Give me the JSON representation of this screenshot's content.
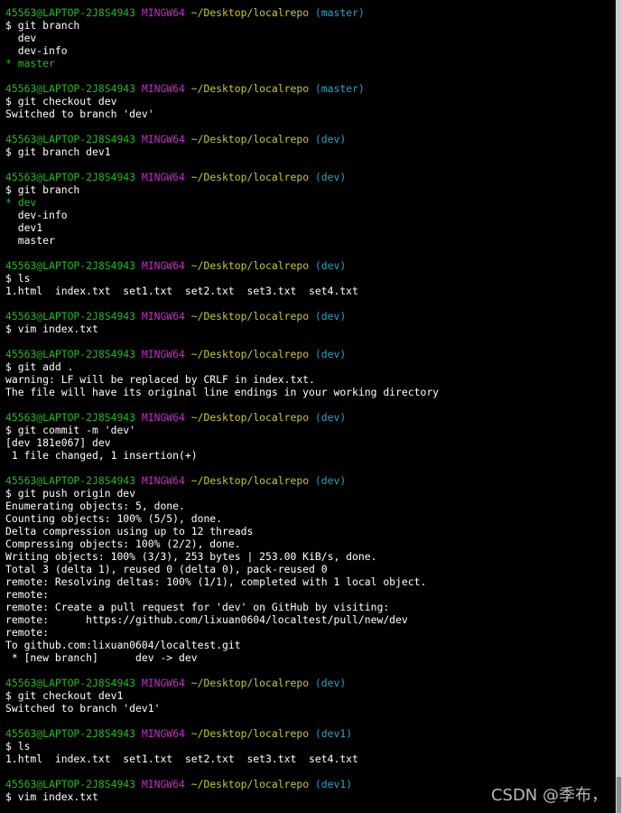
{
  "colors": {
    "background": "#000000",
    "text": "#ffffff",
    "user_host": "#1cbd1c",
    "shell": "#c82bc8",
    "path": "#c8c82b",
    "branch": "#1fa7c8",
    "current_branch": "#1cbd1c"
  },
  "prompt": {
    "user_host": "45563@LAPTOP-2J8S4943",
    "shell": "MINGW64",
    "path": "~/Desktop/localrepo"
  },
  "lines": [
    {
      "type": "prompt",
      "branch": "(master)"
    },
    {
      "type": "cmd",
      "text": "$ git branch"
    },
    {
      "type": "out",
      "text": "  dev"
    },
    {
      "type": "out",
      "text": "  dev-info"
    },
    {
      "type": "cur",
      "text": "* master"
    },
    {
      "type": "blank"
    },
    {
      "type": "prompt",
      "branch": "(master)"
    },
    {
      "type": "cmd",
      "text": "$ git checkout dev"
    },
    {
      "type": "out",
      "text": "Switched to branch 'dev'"
    },
    {
      "type": "blank"
    },
    {
      "type": "prompt",
      "branch": "(dev)"
    },
    {
      "type": "cmd",
      "text": "$ git branch dev1"
    },
    {
      "type": "blank"
    },
    {
      "type": "prompt",
      "branch": "(dev)"
    },
    {
      "type": "cmd",
      "text": "$ git branch"
    },
    {
      "type": "cur",
      "text": "* dev"
    },
    {
      "type": "out",
      "text": "  dev-info"
    },
    {
      "type": "out",
      "text": "  dev1"
    },
    {
      "type": "out",
      "text": "  master"
    },
    {
      "type": "blank"
    },
    {
      "type": "prompt",
      "branch": "(dev)"
    },
    {
      "type": "cmd",
      "text": "$ ls"
    },
    {
      "type": "out",
      "text": "1.html  index.txt  set1.txt  set2.txt  set3.txt  set4.txt"
    },
    {
      "type": "blank"
    },
    {
      "type": "prompt",
      "branch": "(dev)"
    },
    {
      "type": "cmd",
      "text": "$ vim index.txt"
    },
    {
      "type": "blank"
    },
    {
      "type": "prompt",
      "branch": "(dev)"
    },
    {
      "type": "cmd",
      "text": "$ git add ."
    },
    {
      "type": "out",
      "text": "warning: LF will be replaced by CRLF in index.txt."
    },
    {
      "type": "out",
      "text": "The file will have its original line endings in your working directory"
    },
    {
      "type": "blank"
    },
    {
      "type": "prompt",
      "branch": "(dev)"
    },
    {
      "type": "cmd",
      "text": "$ git commit -m 'dev'"
    },
    {
      "type": "out",
      "text": "[dev 181e067] dev"
    },
    {
      "type": "out",
      "text": " 1 file changed, 1 insertion(+)"
    },
    {
      "type": "blank"
    },
    {
      "type": "prompt",
      "branch": "(dev)"
    },
    {
      "type": "cmd",
      "text": "$ git push origin dev"
    },
    {
      "type": "out",
      "text": "Enumerating objects: 5, done."
    },
    {
      "type": "out",
      "text": "Counting objects: 100% (5/5), done."
    },
    {
      "type": "out",
      "text": "Delta compression using up to 12 threads"
    },
    {
      "type": "out",
      "text": "Compressing objects: 100% (2/2), done."
    },
    {
      "type": "out",
      "text": "Writing objects: 100% (3/3), 253 bytes | 253.00 KiB/s, done."
    },
    {
      "type": "out",
      "text": "Total 3 (delta 1), reused 0 (delta 0), pack-reused 0"
    },
    {
      "type": "out",
      "text": "remote: Resolving deltas: 100% (1/1), completed with 1 local object."
    },
    {
      "type": "out",
      "text": "remote:"
    },
    {
      "type": "out",
      "text": "remote: Create a pull request for 'dev' on GitHub by visiting:"
    },
    {
      "type": "out",
      "text": "remote:      https://github.com/lixuan0604/localtest/pull/new/dev"
    },
    {
      "type": "out",
      "text": "remote:"
    },
    {
      "type": "out",
      "text": "To github.com:lixuan0604/localtest.git"
    },
    {
      "type": "out",
      "text": " * [new branch]      dev -> dev"
    },
    {
      "type": "blank"
    },
    {
      "type": "prompt",
      "branch": "(dev)"
    },
    {
      "type": "cmd",
      "text": "$ git checkout dev1"
    },
    {
      "type": "out",
      "text": "Switched to branch 'dev1'"
    },
    {
      "type": "blank"
    },
    {
      "type": "prompt",
      "branch": "(dev1)"
    },
    {
      "type": "cmd",
      "text": "$ ls"
    },
    {
      "type": "out",
      "text": "1.html  index.txt  set1.txt  set2.txt  set3.txt  set4.txt"
    },
    {
      "type": "blank"
    },
    {
      "type": "prompt",
      "branch": "(dev1)"
    },
    {
      "type": "cmd",
      "text": "$ vim index.txt"
    }
  ],
  "watermark": "CSDN @季布，"
}
